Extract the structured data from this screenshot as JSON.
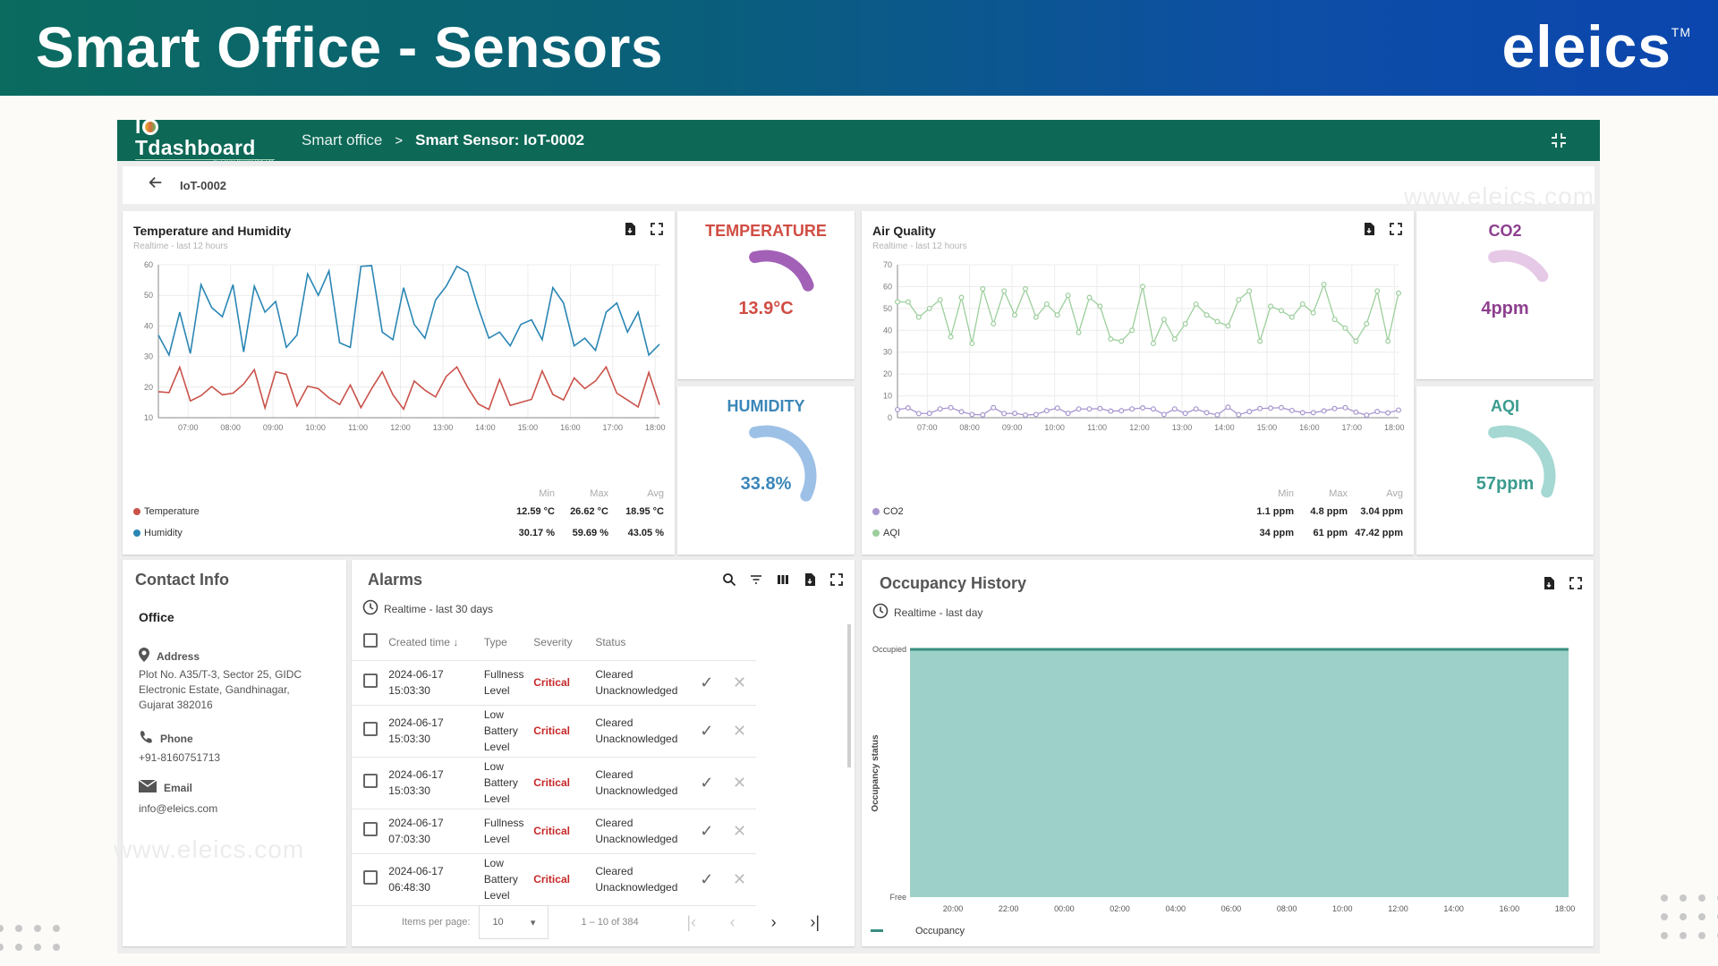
{
  "banner": {
    "title": "Smart Office - Sensors",
    "brand": "eleics",
    "trademark": "TM"
  },
  "watermark": "www.eleics.com",
  "topbar": {
    "logo_main": "IOTdashboard",
    "logo_sub": "by Eleics Design Pvt. Ltd.",
    "breadcrumb_parent": "Smart office",
    "breadcrumb_sep": ">",
    "breadcrumb_current": "Smart Sensor: IoT-0002",
    "collapse_icon": "fullscreen-exit-icon"
  },
  "subbar": {
    "back_icon": "arrow-left-icon",
    "device": "IoT-0002"
  },
  "temp_humidity": {
    "title": "Temperature and Humidity",
    "subtitle": "Realtime - last 12 hours",
    "icons": [
      "file-export-icon",
      "fullscreen-icon"
    ],
    "stats_headers": [
      "Min",
      "Max",
      "Avg"
    ],
    "legend": [
      {
        "name": "Temperature",
        "color": "#c9524a",
        "min": "12.59 °C",
        "max": "26.62 °C",
        "avg": "18.95 °C"
      },
      {
        "name": "Humidity",
        "color": "#2a86b4",
        "min": "30.17 %",
        "max": "59.69 %",
        "avg": "43.05 %"
      }
    ]
  },
  "gauges": {
    "temperature": {
      "label": "TEMPERATURE",
      "value": "13.9°C",
      "fraction": 0.25,
      "label_color": "#d04d44",
      "arc_color": "#a261b7"
    },
    "humidity": {
      "label": "HUMIDITY",
      "value": "33.8%",
      "fraction": 0.42,
      "label_color": "#3b86b8",
      "arc_color": "#9dc1e6"
    },
    "co2": {
      "label": "CO2",
      "value": "4ppm",
      "fraction": 0.2,
      "label_color": "#8e3f8f",
      "arc_color": "#e6c9e6"
    },
    "aqi": {
      "label": "AQI",
      "value": "57ppm",
      "fraction": 0.4,
      "label_color": "#3a9b8e",
      "arc_color": "#a5d8d2"
    }
  },
  "air_quality": {
    "title": "Air Quality",
    "subtitle": "Realtime - last 12 hours",
    "icons": [
      "file-export-icon",
      "fullscreen-icon"
    ],
    "stats_headers": [
      "Min",
      "Max",
      "Avg"
    ],
    "legend": [
      {
        "name": "CO2",
        "color": "#a896cf",
        "min": "1.1 ppm",
        "max": "4.8 ppm",
        "avg": "3.04 ppm"
      },
      {
        "name": "AQI",
        "color": "#9ccf9c",
        "min": "34 ppm",
        "max": "61 ppm",
        "avg": "47.42 ppm"
      }
    ]
  },
  "contact": {
    "title": "Contact Info",
    "office": "Office",
    "address_label": "Address",
    "address": "Plot No. A35/T-3, Sector 25, GIDC Electronic Estate, Gandhinagar, Gujarat 382016",
    "phone_label": "Phone",
    "phone": "+91-8160751713",
    "email_label": "Email",
    "email": "info@eleics.com"
  },
  "alarms": {
    "title": "Alarms",
    "subtitle": "Realtime - last 30 days",
    "toolbar_icons": [
      "search-icon",
      "filter-icon",
      "columns-icon",
      "file-export-icon",
      "fullscreen-icon"
    ],
    "columns": [
      "Created time",
      "Type",
      "Severity",
      "Status"
    ],
    "sort_icon": "arrow-down-icon",
    "rows": [
      {
        "time": "2024-06-17 15:03:30",
        "type": "Fullness Level",
        "severity": "Critical",
        "status": "Cleared Unacknowledged"
      },
      {
        "time": "2024-06-17 15:03:30",
        "type": "Low Battery Level",
        "severity": "Critical",
        "status": "Cleared Unacknowledged"
      },
      {
        "time": "2024-06-17 15:03:30",
        "type": "Low Battery Level",
        "severity": "Critical",
        "status": "Cleared Unacknowledged"
      },
      {
        "time": "2024-06-17 07:03:30",
        "type": "Fullness Level",
        "severity": "Critical",
        "status": "Cleared Unacknowledged"
      },
      {
        "time": "2024-06-17 06:48:30",
        "type": "Low Battery Level",
        "severity": "Critical",
        "status": "Cleared Unacknowledged"
      }
    ],
    "pager": {
      "items_label": "Items per page:",
      "items_value": "10",
      "range": "1 – 10 of 384"
    }
  },
  "occupancy": {
    "title": "Occupancy History",
    "subtitle": "Realtime - last day",
    "icons": [
      "file-export-icon",
      "fullscreen-icon"
    ],
    "legend": "Occupancy"
  },
  "chart_data": [
    {
      "type": "line",
      "title": "Temperature and Humidity",
      "xlabel": "",
      "ylabel": "",
      "x_ticks": [
        "07:00",
        "08:00",
        "09:00",
        "10:00",
        "11:00",
        "12:00",
        "13:00",
        "14:00",
        "15:00",
        "16:00",
        "17:00",
        "18:00"
      ],
      "x_range": [
        6.3,
        18.1
      ],
      "ylim": [
        10,
        60
      ],
      "y_ticks": [
        10,
        20,
        30,
        40,
        50,
        60
      ],
      "grid": true,
      "series": [
        {
          "name": "Humidity",
          "color": "#2a86b4",
          "values": [
            37,
            30.5,
            44.5,
            31,
            53.5,
            46,
            43,
            53.5,
            31.5,
            53,
            44.5,
            48,
            33,
            37,
            57,
            50,
            58,
            34.5,
            33,
            59.5,
            59.7,
            38,
            35.5,
            52.5,
            40.5,
            36,
            48.5,
            53,
            59.5,
            57.5,
            46,
            36,
            38,
            33.5,
            40.5,
            42,
            35.5,
            52.5,
            47.5,
            33.5,
            36,
            32,
            44.5,
            47.5,
            38,
            44.5,
            30.5,
            34
          ]
        },
        {
          "name": "Temperature",
          "color": "#c9524a",
          "values": [
            18.5,
            18.2,
            26.5,
            15.5,
            17.2,
            20.2,
            17.5,
            18,
            21,
            25.7,
            13.2,
            25,
            24.2,
            13.8,
            20.3,
            19.5,
            16.5,
            14.3,
            20.7,
            13.3,
            19.5,
            25,
            17.5,
            12.8,
            22,
            19,
            16.8,
            23.5,
            26.6,
            20,
            14.5,
            12.7,
            22.5,
            14,
            15,
            16,
            25.3,
            17.6,
            15.8,
            23,
            19.5,
            22,
            26.6,
            18,
            15.8,
            13.5,
            24.8,
            14.2
          ]
        }
      ]
    },
    {
      "type": "line",
      "title": "Air Quality",
      "xlabel": "",
      "ylabel": "",
      "x_ticks": [
        "07:00",
        "08:00",
        "09:00",
        "10:00",
        "11:00",
        "12:00",
        "13:00",
        "14:00",
        "15:00",
        "16:00",
        "17:00",
        "18:00"
      ],
      "x_range": [
        6.3,
        18.1
      ],
      "ylim": [
        0,
        70
      ],
      "y_ticks": [
        0,
        10,
        20,
        30,
        40,
        50,
        60,
        70
      ],
      "grid": true,
      "series": [
        {
          "name": "AQI",
          "color": "#9ccf9c",
          "values": [
            53,
            53,
            46,
            50,
            54,
            37,
            55,
            34,
            59,
            43,
            58,
            47,
            59,
            46,
            52,
            47,
            56,
            39,
            55,
            51,
            36,
            35,
            40,
            60,
            34,
            45,
            36,
            43,
            52,
            47,
            44,
            42,
            54,
            58,
            35,
            51,
            49,
            46,
            52,
            48,
            61,
            45,
            41,
            35,
            43,
            58,
            35,
            57
          ]
        },
        {
          "name": "CO2",
          "color": "#a896cf",
          "values": [
            3.7,
            4.5,
            1.9,
            2,
            4,
            4.6,
            2.7,
            1.5,
            1.3,
            4.6,
            1.9,
            2,
            1.2,
            1.5,
            3.2,
            4.4,
            2,
            4,
            4,
            4.2,
            3,
            3.2,
            4,
            4.5,
            4,
            1.5,
            4,
            2,
            4,
            2.3,
            1.3,
            4.8,
            1.4,
            2.8,
            4.2,
            4.4,
            4.6,
            3.3,
            2.3,
            2.3,
            3.1,
            4.2,
            4.6,
            2.5,
            1.2,
            2.8,
            2.2,
            3.5
          ]
        }
      ]
    },
    {
      "type": "area",
      "title": "Occupancy History",
      "xlabel": "",
      "ylabel": "Occupancy status",
      "x_ticks": [
        "20:00",
        "22:00",
        "00:00",
        "02:00",
        "04:00",
        "06:00",
        "08:00",
        "10:00",
        "12:00",
        "14:00",
        "16:00",
        "18:00"
      ],
      "y_ticks": [
        "Free",
        "Occupied"
      ],
      "series": [
        {
          "name": "Occupancy",
          "color": "#3a8e80",
          "fill": "#9dd0c8",
          "values": [
            1,
            1,
            1,
            1,
            1,
            1,
            1,
            1,
            1,
            1,
            1,
            1,
            1
          ]
        }
      ]
    }
  ]
}
